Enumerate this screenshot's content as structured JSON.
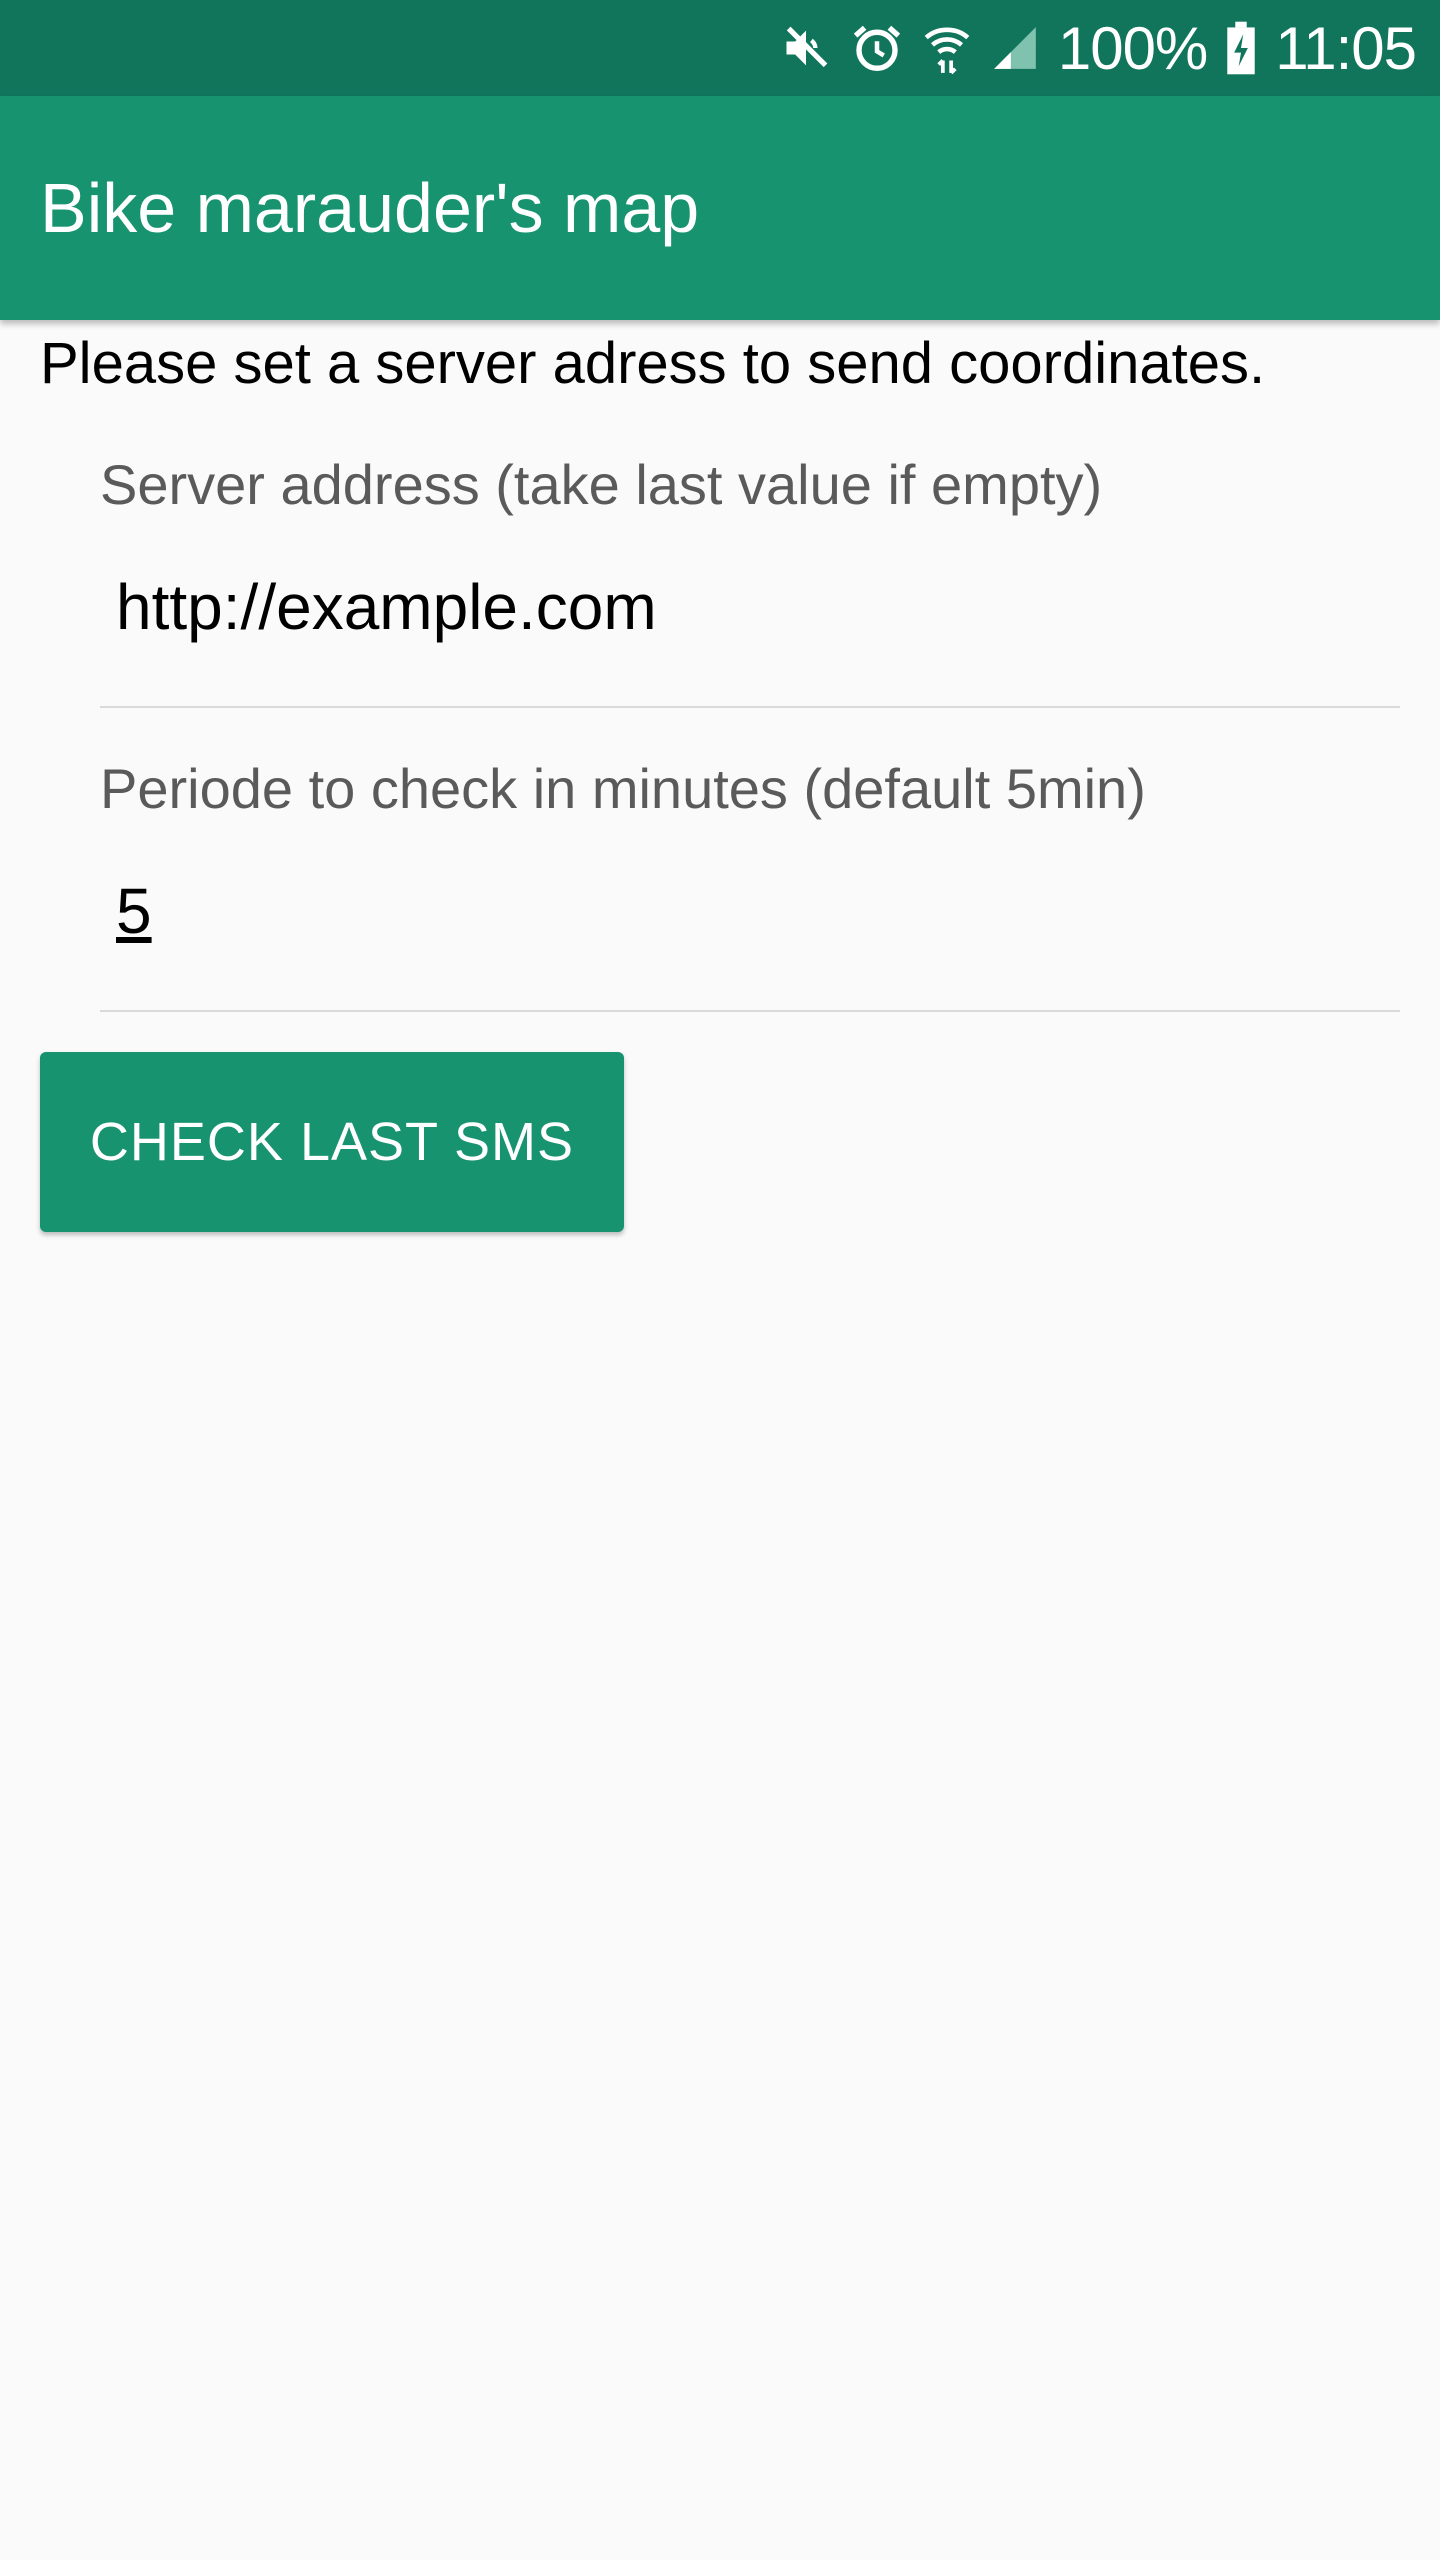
{
  "status_bar": {
    "icons": [
      "mute-icon",
      "alarm-icon",
      "wifi-icon",
      "signal-icon",
      "battery-charging-icon"
    ],
    "battery_percent": "100%",
    "time": "11:05"
  },
  "app_bar": {
    "title": "Bike marauder's map"
  },
  "main": {
    "instructions": "Please set a server adress to send coordinates.",
    "server_field": {
      "label": "Server address (take last value if empty)",
      "value": "http://example.com"
    },
    "period_field": {
      "label": "Periode to check in minutes (default 5min)",
      "value": "5"
    },
    "check_button_label": "CHECK LAST SMS"
  },
  "colors": {
    "status_bar": "#11755c",
    "primary": "#179370",
    "background": "#fafafa"
  }
}
